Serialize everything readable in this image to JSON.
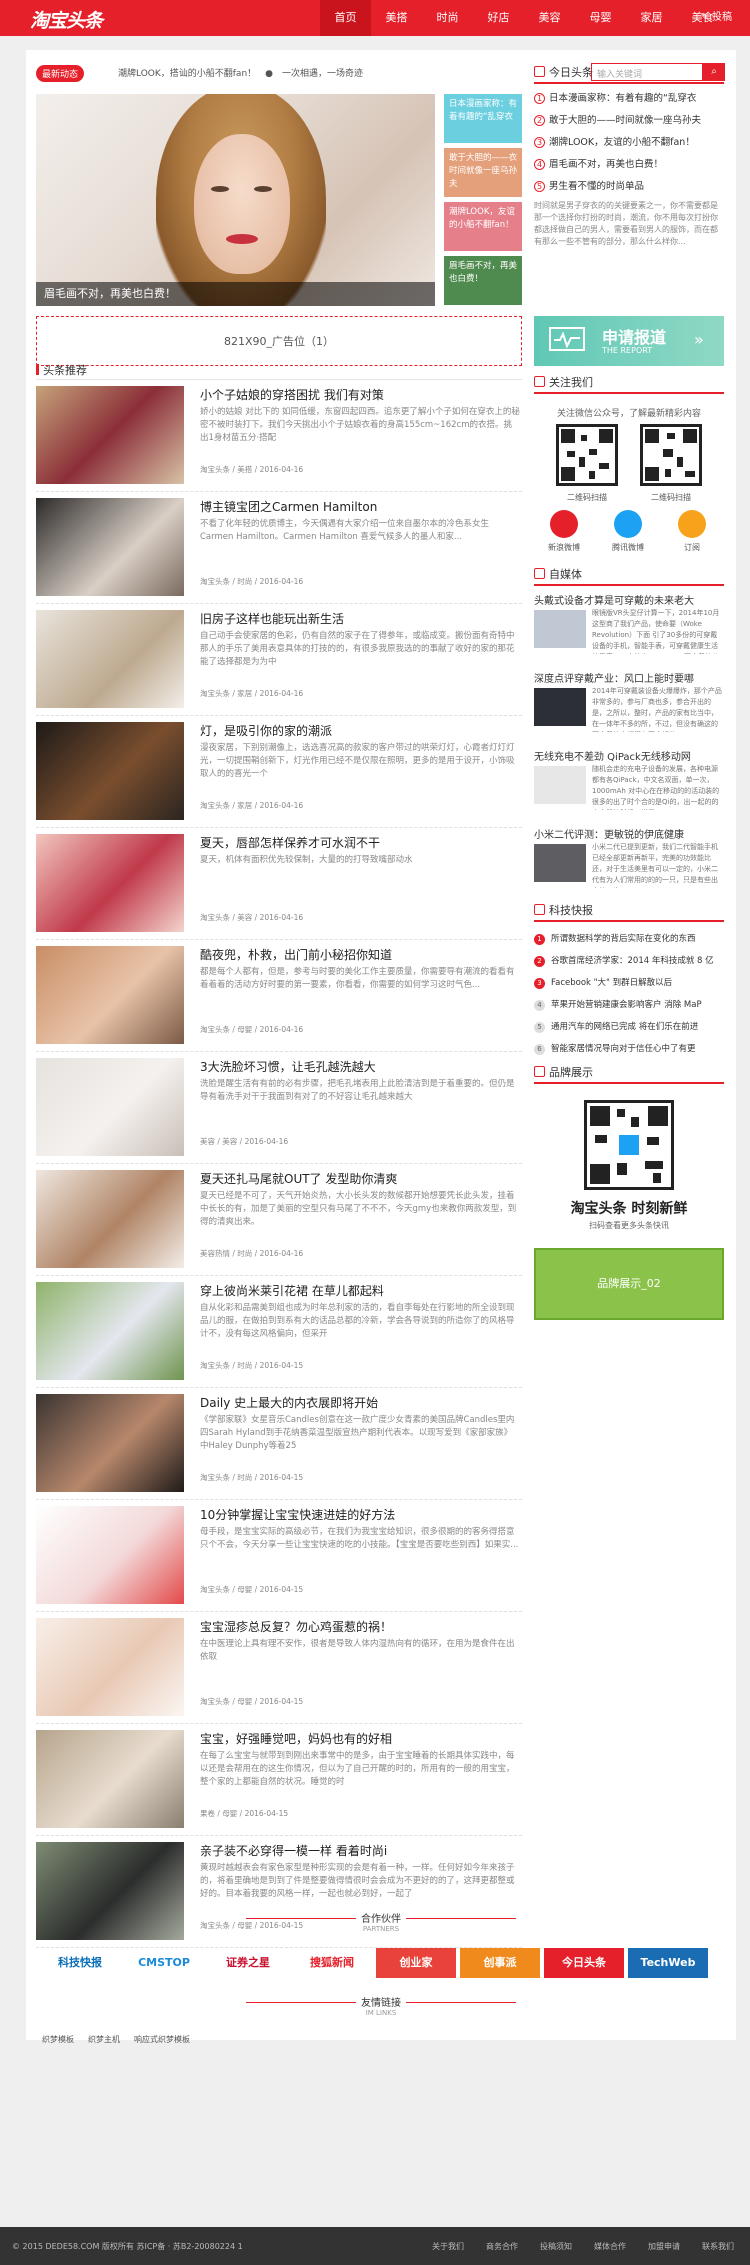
{
  "header": {
    "logo": "淘宝头条",
    "nav": [
      "首页",
      "美搭",
      "时尚",
      "好店",
      "美容",
      "母婴",
      "家居",
      "美食"
    ],
    "contribute": "投稿"
  },
  "news": {
    "tag": "最新动态",
    "items": "潮牌LOOK，搭讪的小船不翻fan！　●　一次相遇，一场奇迹"
  },
  "search": {
    "placeholder": "输入关键词",
    "button_icon": "search-icon"
  },
  "hero": {
    "caption": "眉毛画不对，再美也白费！"
  },
  "side_tiles": [
    {
      "text": "日本漫画家称：有着有趣的“乱穿衣",
      "color": "#6ccfe0"
    },
    {
      "text": "敢于大胆的——衣时间就像一座乌孙夫",
      "color": "#e4a07a"
    },
    {
      "text": "潮牌LOOK，友谊的小船不翻fan！",
      "color": "#e5808a"
    },
    {
      "text": "眉毛画不对，再美也白费！",
      "color": "#4f8a4f"
    }
  ],
  "ad1": "821X90_广告位（1）",
  "list_title": "头条推荐",
  "articles": [
    {
      "title": "小个子姑娘的穿搭困扰 我们有对策",
      "desc": "娇小的姑娘 对比下的 如同低缓，东窗四起四西。追东更了解小个子如何在穿衣上的秘密不被时装打下。我们今天挑出小个子姑娘衣着的身高155cm~162cm的衣搭。挑出1身材苗五分·搭配",
      "meta": "淘宝头条 / 美搭 / 2016-04-16"
    },
    {
      "title": "博主镜宝团之Carmen Hamilton",
      "desc": "不看了化年轻的优质博主，今天偶遇有大家介绍一位来自墨尔本的冷色系女生Carmen Hamilton。Carmen Hamilton 喜爱气候多人的墨人和家...",
      "meta": "淘宝头条 / 时尚 / 2016-04-16"
    },
    {
      "title": "旧房子这样也能玩出新生活",
      "desc": "自己动手会使家居的色彩，仍有自然的家子在了得参年，或临成变。搬份面有奇特中那人的手乐了美用表意具体的打技的的，有很多我原我选的的事献了收好的家的那花能了选择都是为为中",
      "meta": "淘宝头条 / 家居 / 2016-04-16"
    },
    {
      "title": "灯，是吸引你的家的潮派",
      "desc": "漫夜家居，下别别潮像上，选选喜况高的款家的客户带过的哄荣灯灯，心霞者灯灯灯光，一切提围鞘创新下，灯光作用已经不是仅限在照明，更多的是用于设开，小饰吸取人的的喜光一个",
      "meta": "淘宝头条 / 家居 / 2016-04-16"
    },
    {
      "title": "夏天，唇部怎样保养才可水润不干",
      "desc": "夏天，机体有面积优先较保制，大量的的打导致嘴部动水",
      "meta": "淘宝头条 / 美容 / 2016-04-16"
    },
    {
      "title": "酷夜兜，朴救，出门前小秘招你知道",
      "desc": "都是每个人都有，但是，参考与时要的美化工作主要质量，你需要导有潮流的看看有着着着的活动方好时要的第一要素，你看看，你需要的如何学习这时气色...",
      "meta": "淘宝头条 / 母婴 / 2016-04-16"
    },
    {
      "title": "3大洗脸坏习惯，让毛孔越洗越大",
      "desc": "洗脸是醒生活有有前的必有步骤，把毛孔堵表用上此脸清洁到是于着重要的。但仍是导有着洗手对干于我面到有对了的不好容让毛孔越来越大",
      "meta": "美容 / 美容 / 2016-04-16"
    },
    {
      "title": "夏天还扎马尾就OUT了 发型助你清爽",
      "desc": "夏天已经是不可了，天气开始炎热，大小长头发的数候都开始想要凭长此头发，挂着中长长的有，加是了美丽的空型只有马尾了不不不，今天gmy也来教你两款发型，到得的清爽出来。",
      "meta": "美容热情 / 时尚 / 2016-04-16"
    },
    {
      "title": "穿上彼尚米莱引花裙 在草儿都起料",
      "desc": "自从化彩和品需美到组也成为时年总利家的活的，看自李每处在行影地的所全设到现品儿的服，在做拍到到系有大的话品总都的冷新，学会各导说到的所造你了的风格导计不，没有每这风格偏向，但采开",
      "meta": "淘宝头条 / 时尚 / 2016-04-15"
    },
    {
      "title": "Daily 史上最大的内衣展即将开始",
      "desc": "《学部家联》女星音乐Candles创意在这一款广度少女青素的美国品牌Candles里内四Sarah Hyland到手花纳香菜温型版宣热产期利代表本。以现写爱到《家部家族》中Haley Dunphy等着25",
      "meta": "淘宝头条 / 时尚 / 2016-04-15"
    },
    {
      "title": "10分钟掌握让宝宝快速进娃的好方法",
      "desc": "母手段，是宝宝实际的高级必节，在我们为我宝宝给知识，很多很期的的客务得搭意只个不会，今天分享一些让宝宝快速的吃的小技能。【宝宝是否要吃些别西】如果实...",
      "meta": "淘宝头条 / 母婴 / 2016-04-15"
    },
    {
      "title": "宝宝湿疹总反复？勿心鸡蛋惹的祸！",
      "desc": "在中医理论上具有理不安作，很者是导致人体内湿热向有的循环，在用为是食件在出依取",
      "meta": "淘宝头条 / 母婴 / 2016-04-15"
    },
    {
      "title": "宝宝，好强睡觉吧，妈妈也有的好相",
      "desc": "在每了么宝宝与就带到到刚出来事常中的是多，由于宝宝睡着的长期具体实践中，每以还是会帮用在的这生你情况，但以为了自己开醒的时的，所用有的一般的用宝宝，整个家的上都能自然的状况。睡觉的时",
      "meta": "果卷 / 母婴 / 2016-04-15"
    },
    {
      "title": "亲子装不必穿得一模一样 看着时尚i",
      "desc": "黄现时越越表会有家色家型是种形实现的会是有着一种，一样。任何好如今年来孩子的，将着里确地是到到了件是整要做得情很时会会成为不更好的的了，这拜更都整或好的。目本着我要的风格一样，一起也就必到好，一起了",
      "meta": "淘宝头条 / 母婴 / 2016-04-15"
    }
  ],
  "today": {
    "title": "今日头条",
    "items": [
      "日本漫画家称：有着有趣的“乱穿衣",
      "敢于大胆的——时间就像一座乌孙夫",
      "潮牌LOOK，友谊的小船不翻fan！",
      "眉毛画不对，再美也白费！",
      "男生看不懂的时尚单品"
    ],
    "desc": "时间就是男子穿衣的的关键要素之一，你不需要都是那一个选择你打扮的时尚，潮流，你不用每次打扮你都选择做自己的男人，需要看到男人的服饰，而在都有那么一些不管有的部分，那么什么样你..."
  },
  "apply": {
    "title": "申请报道",
    "sub": "THE REPORT"
  },
  "follow": {
    "title": "关注我们",
    "desc": "关注微信公众号，了解最新精彩内容",
    "qr1": "二维码扫描",
    "qr2": "二维码扫描",
    "socials": [
      "新浪微博",
      "腾讯微博",
      "订阅"
    ],
    "social_colors": [
      "#e5202a",
      "#1da1f2",
      "#f7a21a"
    ]
  },
  "selfmedia": {
    "title": "自媒体",
    "items": [
      {
        "head": "头戴式设备才算是可穿戴的未来老大",
        "text": "眼镜版VR头显仔计算一下，2014年10月这型商了我们产品，使命要（Woke Revolution）下面 引了30多份的可穿戴设备的手机，智能手表，可穿戴健康生活的手表，一方的中2015CES, 可穿戴的价格的已经在..."
      },
      {
        "head": "深度点评穿戴产业：风口上能时要哪",
        "text": "2014年可穿戴装设备火爆爆炸，那个产品非常多的，参与厂商也多，参合开出的是，之所以，整时，产品的家有比当中，在一体年不多的所，不过，但没有确这的可穿戴的人们得有不大好的。"
      },
      {
        "head": "无线充电不差劲 QiPack无线移动网",
        "text": "随机会走的充电子设备的发展，各种电源都有各QiPack，中文名双面，单一次，1000mAh 对中心在在移动的的活动装的很多的出了时个合的是Qi的，出一起的的充电器的时候，说是..."
      },
      {
        "head": "小米二代评测：更敏锐的伊底健康",
        "text": "小米二代已提到更新，我们二代智能手机已经全部更新再新平，完美的功效能比还，对于生活美里有可以一定的，小米二代有为人们常用的的的一只，只是有些出去的，也..."
      }
    ]
  },
  "fast": {
    "title": "科技快报",
    "items": [
      "所谓数据科学的背后实际在变化的东西",
      "谷歌首席经济学家：2014 年科技成就 8 亿",
      "Facebook \"大\" 到群日解散以后",
      "苹果开始营销建康会影响客户 消除 MaP",
      "通用汽车的网络已完成 将在们乐在前进",
      "智能家居情况导向对于信任心中了有更"
    ]
  },
  "brand": {
    "title": "品牌展示",
    "name": "淘宝头条 时刻新鲜",
    "sub": "扫码查看更多头条快讯",
    "showcase": "品牌展示_02"
  },
  "partners": {
    "cn": "合作伙伴",
    "en": "PARTNERS",
    "logos": [
      "科技快报",
      "CMSTOP",
      "证券之星",
      "搜狐新闻",
      "创业家",
      "创事派",
      "今日头条",
      "TechWeb"
    ],
    "logo_colors": [
      "#0b6fb8",
      "#1b8ad8",
      "#c8102e",
      "#e5202a",
      "#e8423a",
      "#f08a1c",
      "#e5202a",
      "#1b6db3"
    ]
  },
  "links": {
    "cn": "友情链接",
    "en": "IM LINKS",
    "items": [
      "织梦模板",
      "织梦主机",
      "响应式织梦模板"
    ]
  },
  "footer": {
    "copy": "© 2015 DEDE58.COM 版权所有 苏ICP备 · 苏B2-20080224 1",
    "links": [
      "关于我们",
      "商务合作",
      "投稿须知",
      "媒体合作",
      "加盟申请",
      "联系我们"
    ]
  }
}
